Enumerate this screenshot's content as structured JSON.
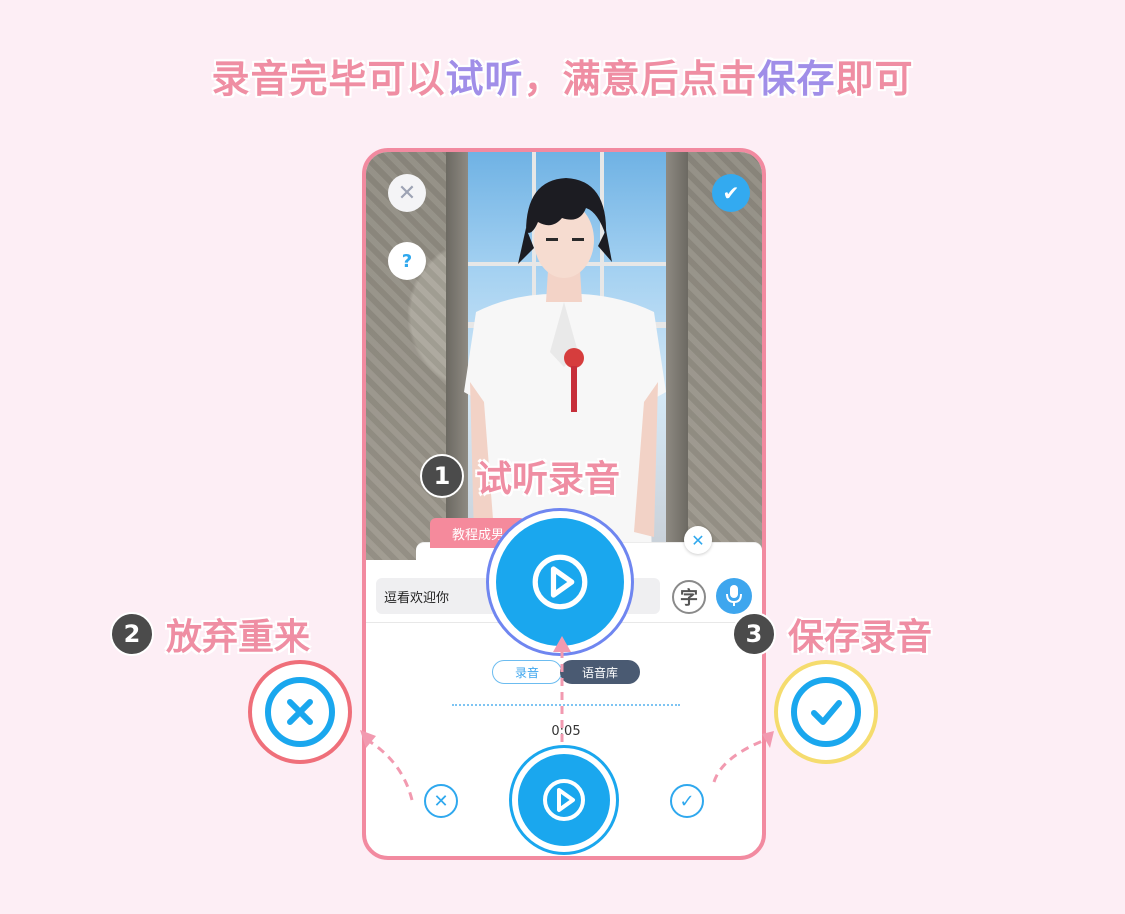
{
  "headline": {
    "part1": "录音完毕可以",
    "part2": "试听",
    "part3": "，满意后点击",
    "part4": "保存",
    "part5": "即可"
  },
  "phone": {
    "panel_tab_label": "教程成男",
    "text_value": "逗看欢迎你",
    "zi_label": "字",
    "tabs": {
      "record": "录音",
      "library": "语音库"
    },
    "timer": "0:05",
    "help_label": "?"
  },
  "steps": [
    {
      "num": "1",
      "label": "试听录音"
    },
    {
      "num": "2",
      "label": "放弃重来"
    },
    {
      "num": "3",
      "label": "保存录音"
    }
  ],
  "colors": {
    "accent_pink": "#ef8ea3",
    "accent_purple": "#a08ee8",
    "play_blue": "#1aa7ee",
    "cancel_ring": "#ef6f7a",
    "confirm_ring": "#f5dc6e"
  },
  "icons": [
    "close-icon",
    "help-icon",
    "check-icon",
    "mic-icon",
    "play-icon"
  ]
}
